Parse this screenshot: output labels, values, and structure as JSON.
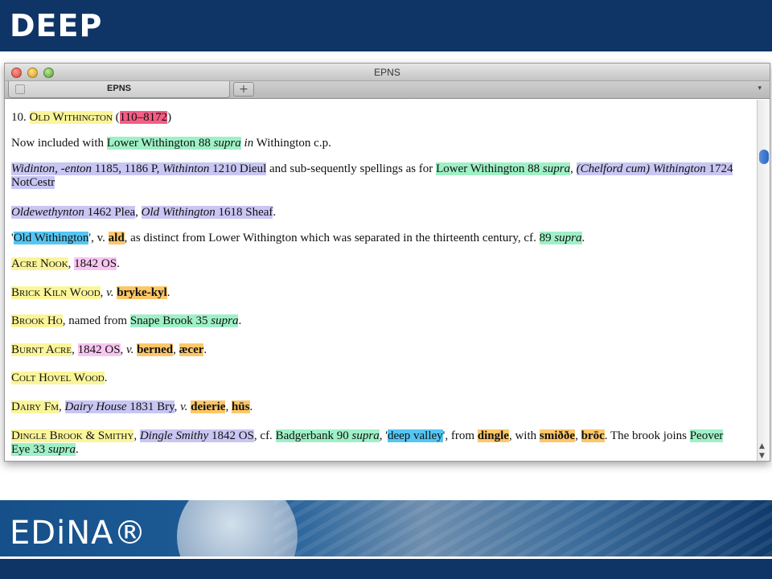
{
  "slide": {
    "title": "DEEP",
    "logo": "EDiNA®",
    "accent": "#0e3566"
  },
  "window": {
    "title": "EPNS",
    "tab_label": "EPNS",
    "new_tab": "+",
    "tab_menu": "▾"
  },
  "entry": {
    "p1": {
      "num": "10.",
      "name": "Old Withington",
      "open": "(",
      "ref": "110–8172",
      "close": ")"
    },
    "p2": {
      "t1": "Now included with ",
      "link": "Lower Withington 88 ",
      "supra": "supra",
      "t2": " ",
      "in": "in",
      "t3": " Withington c.p."
    },
    "p3": {
      "w1": "Widinton, -enton",
      "w2": " 1185, 1186 P, ",
      "w3": "Withinton",
      "w4": " 1210 Dieul",
      "t1": " and sub-sequently spellings as for ",
      "link": "Lower Withington 88 ",
      "supra": "supra",
      "t2": ", ",
      "w5": "(Chelford cum) Withington",
      "w6": " 1724 NotCestr"
    },
    "p4": {
      "w1": "Oldewethynton",
      "w2": " 1462 Plea",
      "t1": ", ",
      "w3": "Old Withington",
      "w4": " 1618 Sheaf",
      "t2": "."
    },
    "p5": {
      "q1": "'",
      "name": "Old Withington",
      "q2": "', v. ",
      "el": "ald",
      "t1": ", as distinct from Lower Withington which was separated in the thirteenth century, cf. ",
      "ref": "89 ",
      "supra": "supra",
      "t2": "."
    },
    "p6": {
      "name": "Acre Nook",
      "t1": ", ",
      "src": "1842 OS",
      "t2": "."
    },
    "p7": {
      "name": "Brick Kiln Wood",
      "t1": ", ",
      "v": "v.",
      "t2": " ",
      "el": "bryke-kyl",
      "t3": "."
    },
    "p8": {
      "name": "Brook Ho",
      "t1": ", named from ",
      "link": "Snape Brook 35 ",
      "supra": "supra",
      "t2": "."
    },
    "p9": {
      "name": "Burnt Acre",
      "t1": ", ",
      "src": "1842 OS",
      "t2": ", ",
      "v": "v.",
      "t3": " ",
      "el1": "berned",
      "t4": ", ",
      "el2": "æcer",
      "t5": "."
    },
    "p10": {
      "name": "Colt Hovel Wood",
      "t1": "."
    },
    "p11": {
      "name": "Dairy Fm",
      "t1": ", ",
      "w1": "Dairy House",
      "w2": " 1831 Bry",
      "t2": ", ",
      "v": "v.",
      "t3": " ",
      "el1": "deierie",
      "t4": ", ",
      "el2": "hūs",
      "t5": "."
    },
    "p12": {
      "name": "Dingle Brook & Smithy",
      "t1": ", ",
      "w1": "Dingle Smithy",
      "w2": " 1842 OS",
      "t2": ", cf. ",
      "link1": "Badgerbank 90 ",
      "supra1": "supra",
      "t3": ", '",
      "gloss": "deep valley",
      "t4": "', from ",
      "el1": "dingle",
      "t5": ", with ",
      "el2": "smiððe",
      "t6": ", ",
      "el3": "brōc",
      "t7": ". The brook joins ",
      "link2": "Peover Eye 33 ",
      "supra2": "supra",
      "t8": "."
    }
  }
}
